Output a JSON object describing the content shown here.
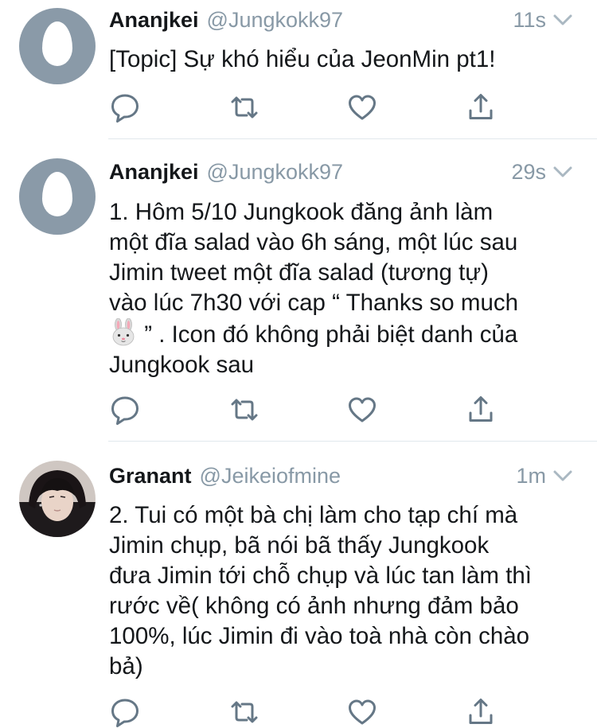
{
  "tweets": [
    {
      "name": "Ananjkei",
      "handle": "@Jungkokk97",
      "time": "11s",
      "avatar": "egg-avatar",
      "text": "[Topic] Sự khó hiểu của JeonMin pt1!"
    },
    {
      "name": "Ananjkei",
      "handle": "@Jungkokk97",
      "time": "29s",
      "avatar": "egg-avatar",
      "lines": [
        "1. Hôm 5/10 Jungkook đăng ảnh làm",
        "một đĩa salad vào 6h sáng, một lúc sau",
        "Jimin tweet một đĩa salad (tương tự)",
        "vào lúc 7h30 với cap “ Thanks so much",
        "” . Icon đó không phải biệt danh của",
        "Jungkook sau"
      ],
      "emoji": "rabbit-face-emoji"
    },
    {
      "name": "Granant",
      "handle": "@Jeikeiofmine",
      "time": "1m",
      "avatar": "photo-avatar",
      "lines": [
        "2. Tui có một bà chị làm cho tạp chí mà",
        "Jimin chụp, bã nói bã thấy Jungkook",
        "đưa Jimin tới chỗ chụp và lúc tan làm thì",
        "rước về( không có ảnh nhưng đảm bảo",
        "100%, lúc Jimin đi vào toà nhà còn chào",
        "bả)"
      ]
    }
  ],
  "icons": {
    "reply": "reply-icon",
    "retweet": "retweet-icon",
    "like": "heart-icon",
    "share": "share-icon",
    "caret": "chevron-down-icon"
  },
  "colors": {
    "text": "#14171a",
    "secondary": "#8899a6",
    "icon": "#657786",
    "divider": "#e1e8ed",
    "egg_background": "#8a9aa8"
  }
}
